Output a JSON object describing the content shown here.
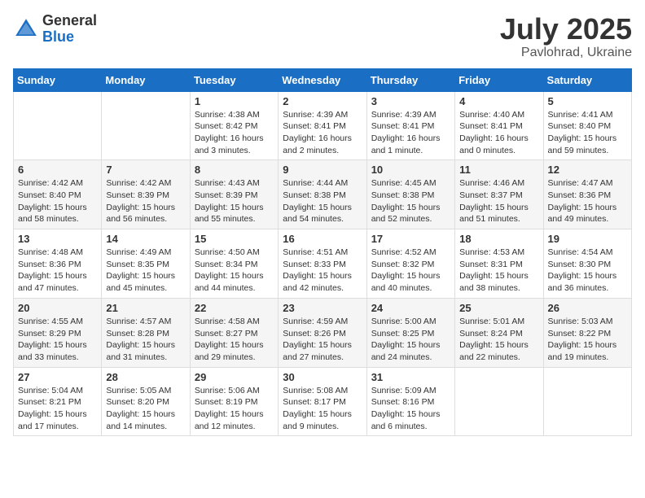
{
  "header": {
    "logo_general": "General",
    "logo_blue": "Blue",
    "month_year": "July 2025",
    "location": "Pavlohrad, Ukraine"
  },
  "weekdays": [
    "Sunday",
    "Monday",
    "Tuesday",
    "Wednesday",
    "Thursday",
    "Friday",
    "Saturday"
  ],
  "weeks": [
    [
      {
        "day": "",
        "info": ""
      },
      {
        "day": "",
        "info": ""
      },
      {
        "day": "1",
        "info": "Sunrise: 4:38 AM\nSunset: 8:42 PM\nDaylight: 16 hours\nand 3 minutes."
      },
      {
        "day": "2",
        "info": "Sunrise: 4:39 AM\nSunset: 8:41 PM\nDaylight: 16 hours\nand 2 minutes."
      },
      {
        "day": "3",
        "info": "Sunrise: 4:39 AM\nSunset: 8:41 PM\nDaylight: 16 hours\nand 1 minute."
      },
      {
        "day": "4",
        "info": "Sunrise: 4:40 AM\nSunset: 8:41 PM\nDaylight: 16 hours\nand 0 minutes."
      },
      {
        "day": "5",
        "info": "Sunrise: 4:41 AM\nSunset: 8:40 PM\nDaylight: 15 hours\nand 59 minutes."
      }
    ],
    [
      {
        "day": "6",
        "info": "Sunrise: 4:42 AM\nSunset: 8:40 PM\nDaylight: 15 hours\nand 58 minutes."
      },
      {
        "day": "7",
        "info": "Sunrise: 4:42 AM\nSunset: 8:39 PM\nDaylight: 15 hours\nand 56 minutes."
      },
      {
        "day": "8",
        "info": "Sunrise: 4:43 AM\nSunset: 8:39 PM\nDaylight: 15 hours\nand 55 minutes."
      },
      {
        "day": "9",
        "info": "Sunrise: 4:44 AM\nSunset: 8:38 PM\nDaylight: 15 hours\nand 54 minutes."
      },
      {
        "day": "10",
        "info": "Sunrise: 4:45 AM\nSunset: 8:38 PM\nDaylight: 15 hours\nand 52 minutes."
      },
      {
        "day": "11",
        "info": "Sunrise: 4:46 AM\nSunset: 8:37 PM\nDaylight: 15 hours\nand 51 minutes."
      },
      {
        "day": "12",
        "info": "Sunrise: 4:47 AM\nSunset: 8:36 PM\nDaylight: 15 hours\nand 49 minutes."
      }
    ],
    [
      {
        "day": "13",
        "info": "Sunrise: 4:48 AM\nSunset: 8:36 PM\nDaylight: 15 hours\nand 47 minutes."
      },
      {
        "day": "14",
        "info": "Sunrise: 4:49 AM\nSunset: 8:35 PM\nDaylight: 15 hours\nand 45 minutes."
      },
      {
        "day": "15",
        "info": "Sunrise: 4:50 AM\nSunset: 8:34 PM\nDaylight: 15 hours\nand 44 minutes."
      },
      {
        "day": "16",
        "info": "Sunrise: 4:51 AM\nSunset: 8:33 PM\nDaylight: 15 hours\nand 42 minutes."
      },
      {
        "day": "17",
        "info": "Sunrise: 4:52 AM\nSunset: 8:32 PM\nDaylight: 15 hours\nand 40 minutes."
      },
      {
        "day": "18",
        "info": "Sunrise: 4:53 AM\nSunset: 8:31 PM\nDaylight: 15 hours\nand 38 minutes."
      },
      {
        "day": "19",
        "info": "Sunrise: 4:54 AM\nSunset: 8:30 PM\nDaylight: 15 hours\nand 36 minutes."
      }
    ],
    [
      {
        "day": "20",
        "info": "Sunrise: 4:55 AM\nSunset: 8:29 PM\nDaylight: 15 hours\nand 33 minutes."
      },
      {
        "day": "21",
        "info": "Sunrise: 4:57 AM\nSunset: 8:28 PM\nDaylight: 15 hours\nand 31 minutes."
      },
      {
        "day": "22",
        "info": "Sunrise: 4:58 AM\nSunset: 8:27 PM\nDaylight: 15 hours\nand 29 minutes."
      },
      {
        "day": "23",
        "info": "Sunrise: 4:59 AM\nSunset: 8:26 PM\nDaylight: 15 hours\nand 27 minutes."
      },
      {
        "day": "24",
        "info": "Sunrise: 5:00 AM\nSunset: 8:25 PM\nDaylight: 15 hours\nand 24 minutes."
      },
      {
        "day": "25",
        "info": "Sunrise: 5:01 AM\nSunset: 8:24 PM\nDaylight: 15 hours\nand 22 minutes."
      },
      {
        "day": "26",
        "info": "Sunrise: 5:03 AM\nSunset: 8:22 PM\nDaylight: 15 hours\nand 19 minutes."
      }
    ],
    [
      {
        "day": "27",
        "info": "Sunrise: 5:04 AM\nSunset: 8:21 PM\nDaylight: 15 hours\nand 17 minutes."
      },
      {
        "day": "28",
        "info": "Sunrise: 5:05 AM\nSunset: 8:20 PM\nDaylight: 15 hours\nand 14 minutes."
      },
      {
        "day": "29",
        "info": "Sunrise: 5:06 AM\nSunset: 8:19 PM\nDaylight: 15 hours\nand 12 minutes."
      },
      {
        "day": "30",
        "info": "Sunrise: 5:08 AM\nSunset: 8:17 PM\nDaylight: 15 hours\nand 9 minutes."
      },
      {
        "day": "31",
        "info": "Sunrise: 5:09 AM\nSunset: 8:16 PM\nDaylight: 15 hours\nand 6 minutes."
      },
      {
        "day": "",
        "info": ""
      },
      {
        "day": "",
        "info": ""
      }
    ]
  ]
}
